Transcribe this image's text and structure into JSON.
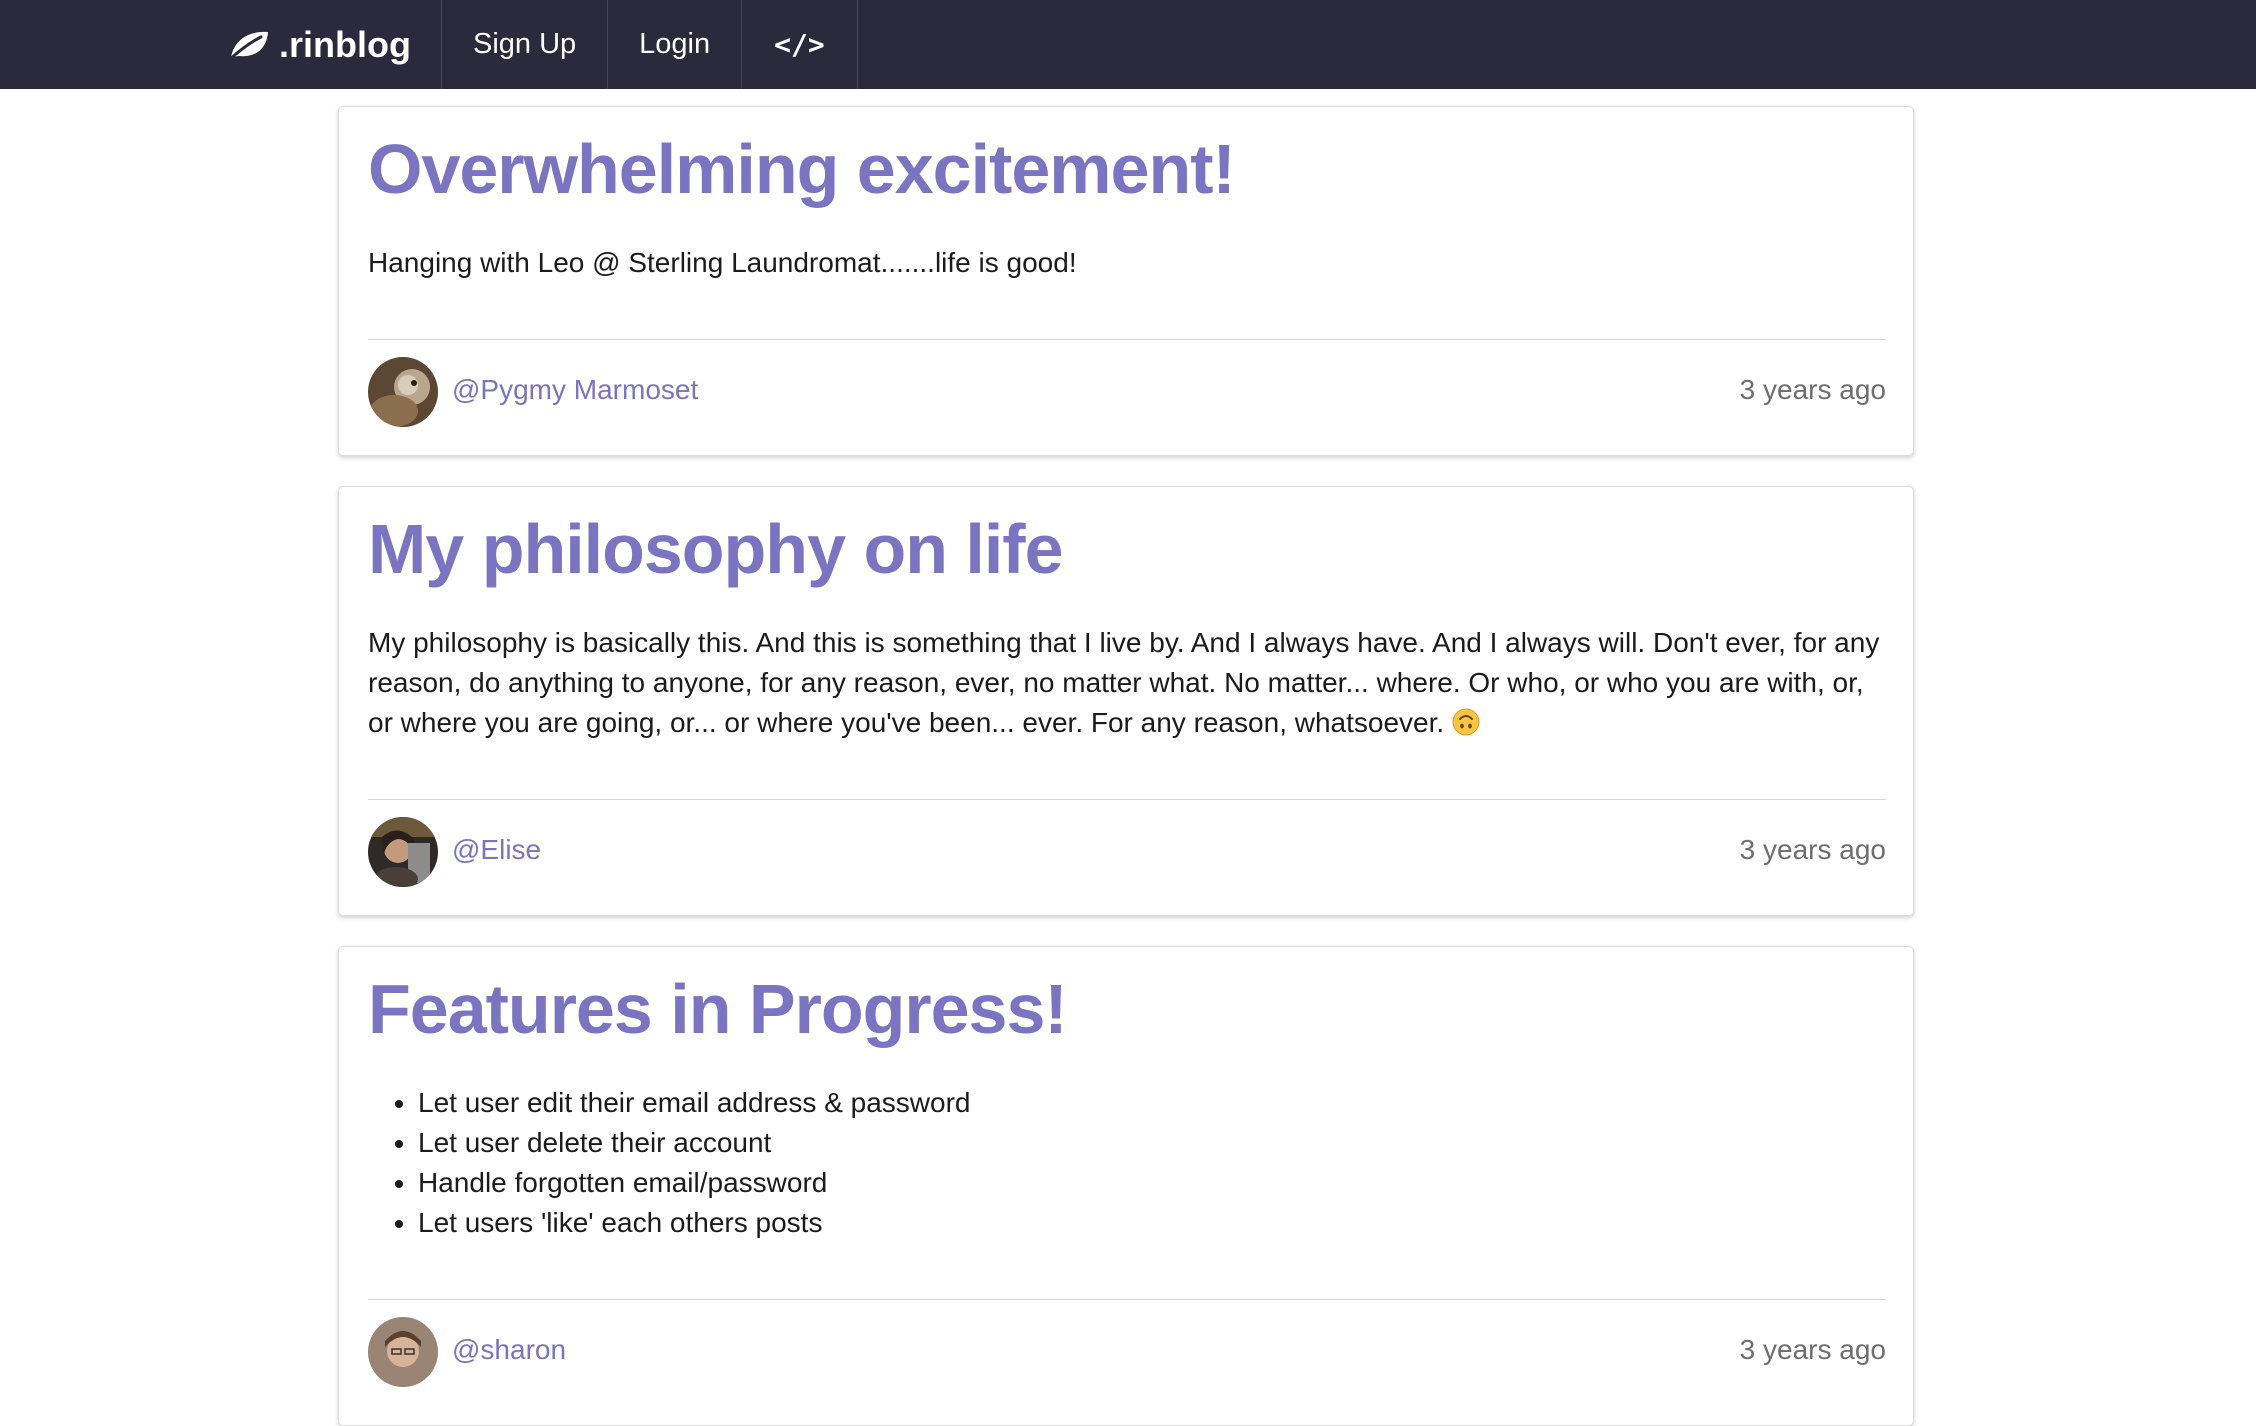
{
  "nav": {
    "brand": ".rinblog",
    "links": [
      "Sign Up",
      "Login",
      "</>"
    ]
  },
  "posts": [
    {
      "title": "Overwhelming excitement!",
      "body": "Hanging with Leo @ Sterling Laundromat.......life is good!",
      "author": "@Pygmy Marmoset",
      "time": "3 years ago"
    },
    {
      "title": "My philosophy on life",
      "body": "My philosophy is basically this. And this is something that I live by. And I always have. And I always will. Don't ever, for any reason, do anything to anyone, for any reason, ever, no matter what. No matter... where. Or who, or who you are with, or, or where you are going, or... or where you've been... ever. For any reason, whatsoever.",
      "emoji": "upside-down-face-icon",
      "author": "@Elise",
      "time": "3 years ago"
    },
    {
      "title": "Features in Progress!",
      "items": [
        "Let user edit their email address & password",
        "Let user delete their account",
        "Handle forgotten email/password",
        "Let users 'like' each others posts"
      ],
      "author": "@sharon",
      "time": "3 years ago"
    }
  ],
  "colors": {
    "navbar": "#2b2a3c",
    "accent": "#7a74c3",
    "text": "#1b1b1b",
    "muted": "#6e6e6e"
  }
}
